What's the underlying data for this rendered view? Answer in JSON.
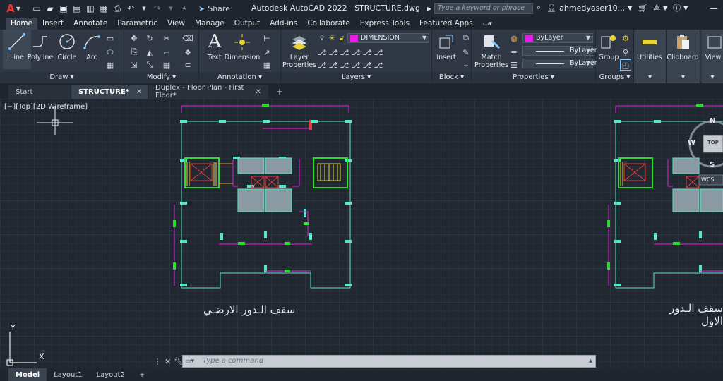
{
  "titlebar": {
    "logo": "A",
    "share_label": "Share",
    "app_title": "Autodesk AutoCAD 2022",
    "file_name": "STRUCTURE.dwg",
    "search_placeholder": "Type a keyword or phrase",
    "user": "ahmedyaser10..."
  },
  "ribbon_tabs": [
    "Home",
    "Insert",
    "Annotate",
    "Parametric",
    "View",
    "Manage",
    "Output",
    "Add-ins",
    "Collaborate",
    "Express Tools",
    "Featured Apps"
  ],
  "panels": {
    "draw": {
      "title": "Draw",
      "line": "Line",
      "polyline": "Polyline",
      "circle": "Circle",
      "arc": "Arc"
    },
    "modify": {
      "title": "Modify"
    },
    "annotation": {
      "title": "Annotation",
      "text": "Text",
      "dimension": "Dimension"
    },
    "layers": {
      "title": "Layers",
      "layer_properties_1": "Layer",
      "layer_properties_2": "Properties",
      "current_layer": "DIMENSION"
    },
    "block": {
      "title": "Block",
      "insert": "Insert"
    },
    "properties": {
      "title": "Properties",
      "match_1": "Match",
      "match_2": "Properties",
      "color": "ByLayer",
      "linetype": "ByLayer",
      "lineweight": "ByLayer"
    },
    "groups": {
      "title": "Groups",
      "group": "Group"
    },
    "utilities": {
      "label": "Utilities"
    },
    "clipboard": {
      "label": "Clipboard"
    },
    "view": {
      "label": "View"
    }
  },
  "doc_tabs": [
    {
      "label": "Start"
    },
    {
      "label": "STRUCTURE*"
    },
    {
      "label": "Duplex - Floor Plan - First Floor*"
    }
  ],
  "canvas": {
    "view_label": "[−][Top][2D Wireframe]",
    "caption_left": "سقف الـدور الارضـي",
    "caption_right": "سقف الـدور الاول",
    "viewcube": {
      "n": "N",
      "w": "W",
      "s": "S",
      "top": "TOP",
      "wcs": "WCS"
    },
    "ucs": {
      "x": "X",
      "y": "Y"
    }
  },
  "command": {
    "placeholder": "Type a command"
  },
  "layout_tabs": [
    "Model",
    "Layout1",
    "Layout2"
  ],
  "colors": {
    "cyan": "#56e8c8",
    "magenta": "#e81de8",
    "green": "#2bdd2b",
    "yellow": "#e8d23a",
    "orange": "#e89a3a",
    "red": "#e83a3a",
    "grey_fill": "#8a9aa3"
  }
}
